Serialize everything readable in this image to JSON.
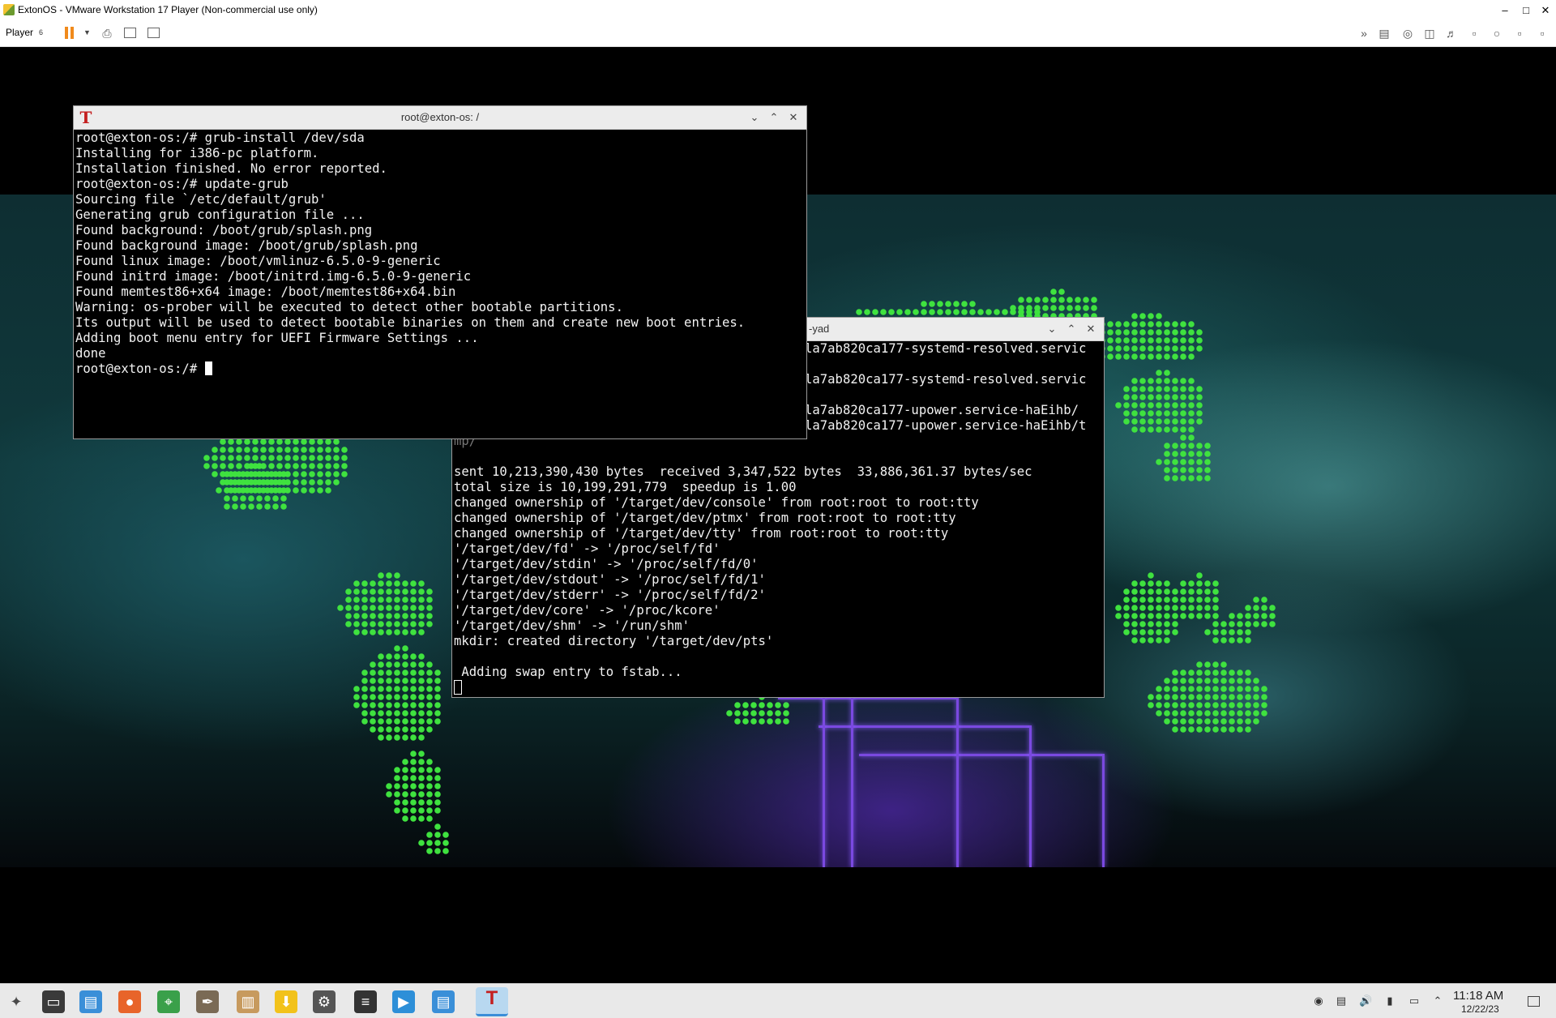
{
  "host": {
    "title": "ExtonOS - VMware Workstation 17 Player (Non-commercial use only)",
    "player_label": "Player"
  },
  "terminal1": {
    "title": "root@exton-os: /",
    "lines": [
      "root@exton-os:/# grub-install /dev/sda",
      "Installing for i386-pc platform.",
      "Installation finished. No error reported.",
      "root@exton-os:/# update-grub",
      "Sourcing file `/etc/default/grub'",
      "Generating grub configuration file ...",
      "Found background: /boot/grub/splash.png",
      "Found background image: /boot/grub/splash.png",
      "Found linux image: /boot/vmlinuz-6.5.0-9-generic",
      "Found initrd image: /boot/initrd.img-6.5.0-9-generic",
      "Found memtest86+x64 image: /boot/memtest86+x64.bin",
      "Warning: os-prober will be executed to detect other bootable partitions.",
      "Its output will be used to detect bootable binaries on them and create new boot entries.",
      "Adding boot menu entry for UEFI Firmware Settings ...",
      "done"
    ],
    "prompt": "root@exton-os:/# "
  },
  "terminal2": {
    "title": "-yad",
    "visible_lines": [
      "la7ab820ca177-systemd-resolved.servic",
      "",
      "la7ab820ca177-systemd-resolved.servic",
      "",
      "la7ab820ca177-upower.service-haEihb/",
      "la7ab820ca177-upower.service-haEihb/t"
    ],
    "partial_line": "mp/",
    "lines": [
      "",
      "sent 10,213,390,430 bytes  received 3,347,522 bytes  33,886,361.37 bytes/sec",
      "total size is 10,199,291,779  speedup is 1.00",
      "changed ownership of '/target/dev/console' from root:root to root:tty",
      "changed ownership of '/target/dev/ptmx' from root:root to root:tty",
      "changed ownership of '/target/dev/tty' from root:root to root:tty",
      "'/target/dev/fd' -> '/proc/self/fd'",
      "'/target/dev/stdin' -> '/proc/self/fd/0'",
      "'/target/dev/stdout' -> '/proc/self/fd/1'",
      "'/target/dev/stderr' -> '/proc/self/fd/2'",
      "'/target/dev/core' -> '/proc/kcore'",
      "'/target/dev/shm' -> '/run/shm'",
      "mkdir: created directory '/target/dev/pts'",
      "",
      " Adding swap entry to fstab..."
    ]
  },
  "taskbar": {
    "apps": [
      {
        "icon": "start-menu-icon",
        "color": "#4a4a4a"
      },
      {
        "icon": "monitor-icon",
        "color": "#3a3a3a"
      },
      {
        "icon": "file-manager-icon",
        "color": "#3a8fd8"
      },
      {
        "icon": "firefox-icon",
        "color": "#e8642a"
      },
      {
        "icon": "maps-icon",
        "color": "#3aa04a"
      },
      {
        "icon": "gimp-icon",
        "color": "#7a6a55"
      },
      {
        "icon": "archive-icon",
        "color": "#c79a5e"
      },
      {
        "icon": "download-icon",
        "color": "#f2c21a"
      },
      {
        "icon": "settings-tool-icon",
        "color": "#555555"
      },
      {
        "icon": "system-monitor-icon",
        "color": "#333333"
      },
      {
        "icon": "store-icon",
        "color": "#2d8fd8"
      },
      {
        "icon": "folder-icon",
        "color": "#3a8fd8"
      },
      {
        "icon": "terminal-icon",
        "color": "#c41f1f"
      }
    ],
    "clock_time": "11:18 AM",
    "clock_date": "12/22/23"
  },
  "colors": {
    "terminal_bg": "#000000",
    "terminal_fg": "#f2f2f2",
    "dot_green": "#3fe23f",
    "circuit_purple": "#7a49e0"
  }
}
